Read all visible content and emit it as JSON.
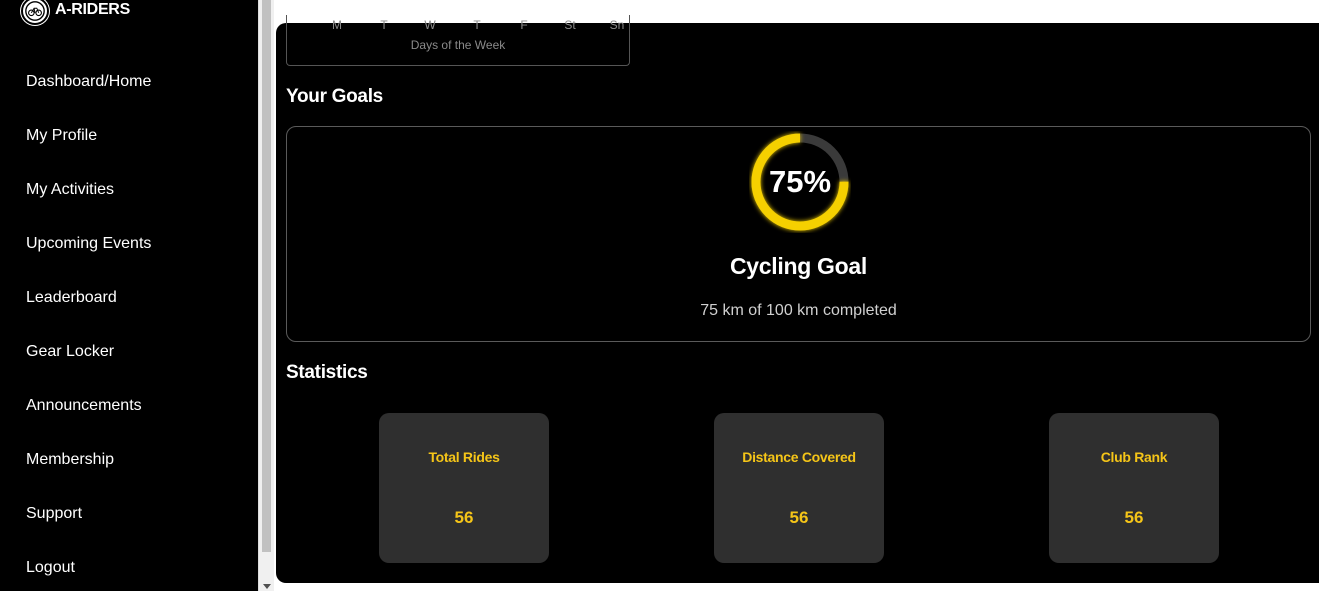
{
  "brand": {
    "name": "A-RIDERS",
    "logo_icon": "bicycle-club-logo-icon"
  },
  "sidebar": {
    "items": [
      {
        "label": "Dashboard/Home"
      },
      {
        "label": "My Profile"
      },
      {
        "label": "My Activities"
      },
      {
        "label": "Upcoming Events"
      },
      {
        "label": "Leaderboard"
      },
      {
        "label": "Gear Locker"
      },
      {
        "label": "Announcements"
      },
      {
        "label": "Membership"
      },
      {
        "label": "Support"
      },
      {
        "label": "Logout"
      }
    ]
  },
  "weekly_chart": {
    "days": [
      "M",
      "T",
      "W",
      "T",
      "F",
      "St",
      "Sn"
    ],
    "xlabel": "Days of the Week"
  },
  "goals": {
    "section_title": "Your Goals",
    "progress_percent": 75,
    "progress_label": "75%",
    "title": "Cycling Goal",
    "description": "75 km of 100 km completed",
    "ring_color": "#f5d000",
    "track_color": "#3a3a3a"
  },
  "statistics": {
    "section_title": "Statistics",
    "cards": [
      {
        "label": "Total Rides",
        "value": "56"
      },
      {
        "label": "Distance Covered",
        "value": "56"
      },
      {
        "label": "Club Rank",
        "value": "56"
      }
    ]
  },
  "colors": {
    "accent": "#f5c518",
    "background": "#000000",
    "card": "#2f2f2f"
  }
}
